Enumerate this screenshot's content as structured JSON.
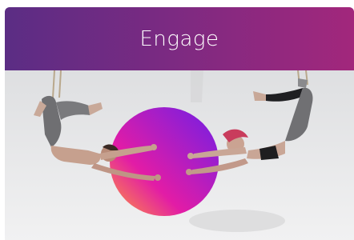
{
  "card": {
    "title": "Engage"
  },
  "image": {
    "subject": "two-aerialists-trapeze-photo",
    "accent_orb_colors": [
      "#ff9a3c",
      "#e21ca6",
      "#7b1fe0"
    ],
    "header_gradient": [
      "#5b2d84",
      "#a2277c"
    ]
  }
}
